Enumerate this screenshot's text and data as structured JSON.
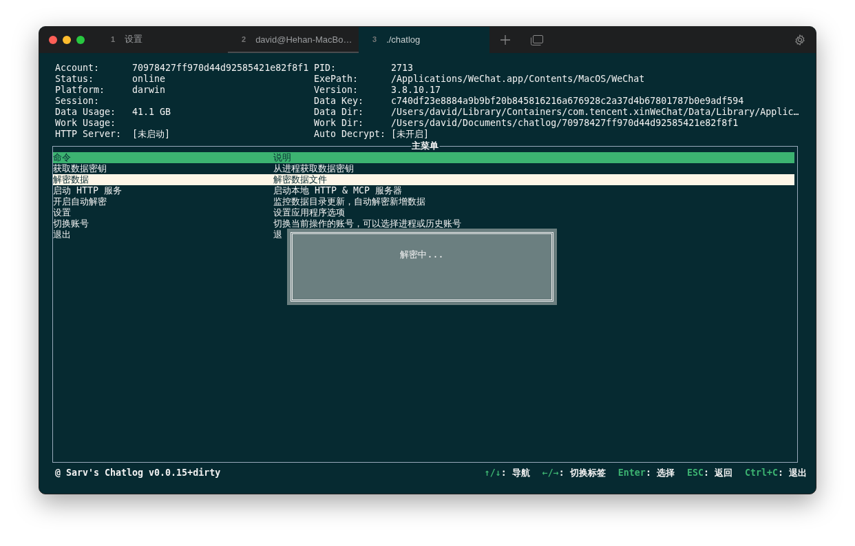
{
  "tabs": [
    {
      "number": "1",
      "title": "设置",
      "selected": false
    },
    {
      "number": "2",
      "title": "david@Hehan-MacBo…",
      "selected": false
    },
    {
      "number": "3",
      "title": "./chatlog",
      "selected": true
    }
  ],
  "info_left": [
    {
      "label": "Account:",
      "value": "70978427ff970d44d92585421e82f8f1"
    },
    {
      "label": "Status:",
      "value": "online"
    },
    {
      "label": "Platform:",
      "value": "darwin"
    },
    {
      "label": "Session:"
    },
    {
      "label": "Data Usage:",
      "value": "41.1 GB"
    },
    {
      "label": "Work Usage:"
    },
    {
      "label": "HTTP Server:",
      "value": "[未启动]"
    }
  ],
  "info_right": [
    {
      "label": "PID:",
      "value": "2713"
    },
    {
      "label": "ExePath:",
      "value": "/Applications/WeChat.app/Contents/MacOS/WeChat"
    },
    {
      "label": "Version:",
      "value": "3.8.10.17"
    },
    {
      "label": "Data Key:",
      "value": "c740df23e8884a9b9bf20b845816216a676928c2a37d4b67801787b0e9adf594"
    },
    {
      "label": "Data Dir:",
      "value": "/Users/david/Library/Containers/com.tencent.xinWeChat/Data/Library/Applic…"
    },
    {
      "label": "Work Dir:",
      "value": "/Users/david/Documents/chatlog/70978427ff970d44d92585421e82f8f1"
    },
    {
      "label": "Auto Decrypt:",
      "value": "[未开启]"
    }
  ],
  "menu": {
    "title": "主菜单",
    "columns": [
      "命令",
      "说明"
    ],
    "rows": [
      {
        "command": "获取数据密钥",
        "description": "从进程获取数据密钥",
        "selected": false
      },
      {
        "command": "解密数据",
        "description": "解密数据文件",
        "selected": true
      },
      {
        "command": "启动 HTTP 服务",
        "description": "启动本地 HTTP & MCP 服务器",
        "selected": false
      },
      {
        "command": "开启自动解密",
        "description": "监控数据目录更新，自动解密新增数据",
        "selected": false
      },
      {
        "command": "设置",
        "description": "设置应用程序选项",
        "selected": false
      },
      {
        "command": "切换账号",
        "description": "切换当前操作的账号，可以选择进程或历史账号",
        "selected": false
      },
      {
        "command": "退出",
        "description": "退",
        "selected": false
      }
    ]
  },
  "dialog": {
    "message": "解密中..."
  },
  "status_bar": {
    "title": "@ Sarv's Chatlog v0.0.15+dirty",
    "hints": [
      {
        "key": "↑/↓",
        "label": ": 导航"
      },
      {
        "key": "←/→",
        "label": ": 切换标签"
      },
      {
        "key": "Enter",
        "label": ": 选择"
      },
      {
        "key": "ESC",
        "label": ": 返回"
      },
      {
        "key": "Ctrl+C",
        "label": ": 退出"
      }
    ]
  }
}
